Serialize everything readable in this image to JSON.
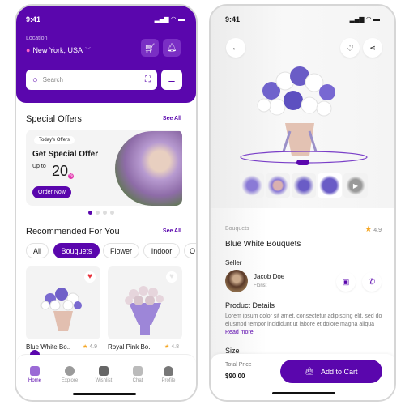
{
  "colors": {
    "brand": "#5a06ad",
    "star": "#f5a623",
    "heart": "#e8323c"
  },
  "home": {
    "status_time": "9:41",
    "location_label": "Location",
    "location_value": "New York, USA",
    "search_placeholder": "Search",
    "special_offers": {
      "title": "Special Offers",
      "see_all": "See All"
    },
    "banner": {
      "tag": "Today's Offers",
      "headline": "Get Special Offer",
      "up_to": "Up to",
      "value": "20",
      "percent": "%",
      "button": "Order Now"
    },
    "carousel": {
      "count": 4,
      "active": 0
    },
    "recommended": {
      "title": "Recommended For You",
      "see_all": "See All"
    },
    "chips": [
      {
        "label": "All"
      },
      {
        "label": "Bouquets",
        "active": true
      },
      {
        "label": "Flower"
      },
      {
        "label": "Indoor"
      },
      {
        "label": "O"
      }
    ],
    "products": [
      {
        "name": "Blue White Bo..",
        "rating": "4.9",
        "favorite": true
      },
      {
        "name": "Royal Pink Bo..",
        "rating": "4.8",
        "favorite": false
      }
    ],
    "nav": [
      {
        "label": "Home",
        "icon": "home-icon",
        "active": true
      },
      {
        "label": "Explore",
        "icon": "map-pin-icon"
      },
      {
        "label": "Wishlist",
        "icon": "heart-icon"
      },
      {
        "label": "Chat",
        "icon": "chat-icon"
      },
      {
        "label": "Profile",
        "icon": "user-icon"
      }
    ]
  },
  "detail": {
    "status_time": "9:41",
    "category": "Bouquets",
    "rating": "4.9",
    "title": "Blue White Bouquets",
    "seller_label": "Seller",
    "seller_name": "Jacob Doe",
    "seller_role": "Florist",
    "details_title": "Product Details",
    "description": "Lorem ipsum dolor sit amet, consectetur adipiscing elit, sed do eiusmod tempor incididunt ut labore et dolore magna aliqua",
    "read_more": "Read more",
    "size_label": "Size",
    "total_label": "Total Price",
    "total_value": "$90.00",
    "add_to_cart": "Add to Cart"
  }
}
